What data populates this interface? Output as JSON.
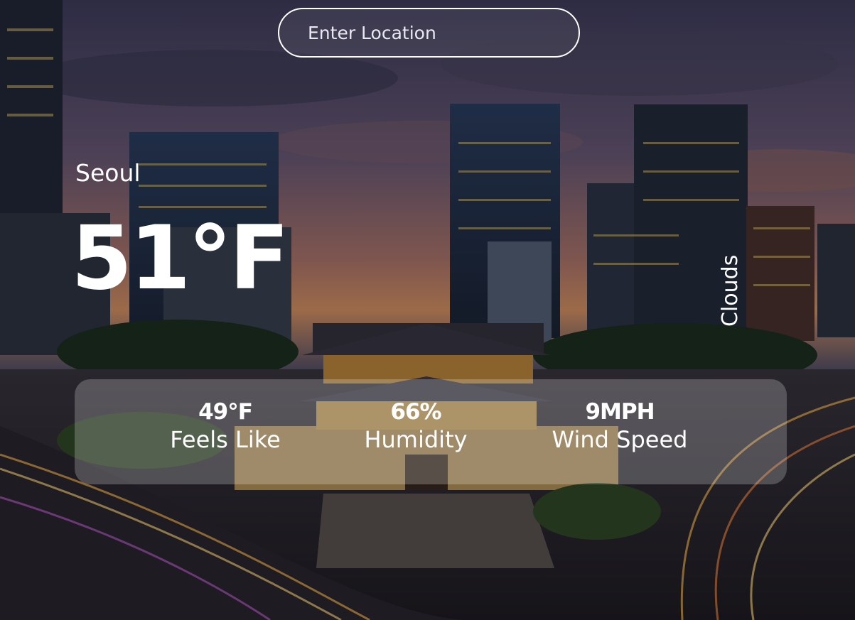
{
  "search": {
    "placeholder": "Enter Location",
    "value": ""
  },
  "location": {
    "city": "Seoul"
  },
  "weather": {
    "temperature": "51°F",
    "condition": "Clouds"
  },
  "stats": [
    {
      "value": "49°F",
      "label": "Feels Like"
    },
    {
      "value": "66%",
      "label": "Humidity"
    },
    {
      "value": "9MPH",
      "label": "Wind Speed"
    }
  ],
  "colors": {
    "text": "#ffffff",
    "sky_top": "#4b4a6a",
    "sky_bottom": "#d98a5e",
    "panel": "rgba(255,255,255,0.22)"
  }
}
